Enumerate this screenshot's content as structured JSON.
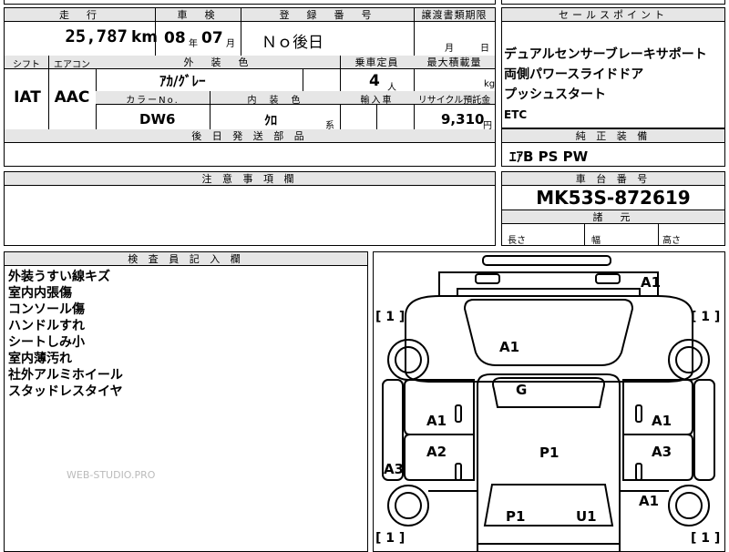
{
  "top_left": {
    "headers": {
      "mileage": "走　行",
      "inspection": "車　検",
      "registration": "登　録　番　号",
      "transfer_docs": "譲渡書類期限",
      "shift": "シフト",
      "ac": "エアコン",
      "exterior_color": "外　装　色",
      "capacity": "乗車定員",
      "max_load": "最大積載量",
      "color_no": "カラーNo.",
      "interior_color": "内　装　色",
      "import": "輸入車",
      "recycle": "リサイクル預託金",
      "later_parts": "後 日 発 送 部 品"
    },
    "values": {
      "mileage": "25,787",
      "mileage_unit": "km",
      "inspection_year": "08",
      "year_unit": "年",
      "inspection_month": "07",
      "month_unit": "月",
      "registration": "Ｎｏ後日",
      "transfer_month_unit": "月",
      "transfer_day_unit": "日",
      "shift": "IAT",
      "ac": "AAC",
      "exterior_color": "ｱｶ/ｸﾞﾚｰ",
      "capacity": "4",
      "capacity_unit": "人",
      "max_load_unit": "kg",
      "color_no": "DW6",
      "interior_color": "ｸﾛ",
      "interior_suffix": "系",
      "recycle": "9,310",
      "recycle_unit": "円"
    }
  },
  "sales_points": {
    "header": "セールスポイント",
    "items": [
      "デュアルセンサーブレーキサポート",
      "両側パワースライドドア",
      "プッシュスタート",
      "ETC"
    ]
  },
  "genuine_equipment": {
    "header": "純 正 装 備",
    "value": "ｴｱB PS PW"
  },
  "caution": {
    "header": "注 意 事 項 欄"
  },
  "chassis": {
    "header": "車 台 番 号",
    "value": "MK53S-872619"
  },
  "dimensions": {
    "header": "諸　元",
    "length": "長さ",
    "width": "幅",
    "height": "高さ"
  },
  "inspector": {
    "header": "検 査 員 記 入 欄",
    "notes": [
      "外装うすい線キズ",
      "室内内張傷",
      "コンソール傷",
      "ハンドルすれ",
      "シートしみ小",
      "室内薄汚れ",
      "社外アルミホイール",
      "スタッドレスタイヤ"
    ],
    "watermark": "WEB-STUDIO.PRO"
  },
  "diagram": {
    "marks": [
      "A1",
      "A1",
      "G",
      "A1",
      "A1",
      "A2",
      "P1",
      "A3",
      "A3",
      "A1",
      "P1",
      "U1"
    ],
    "tire_labels": [
      "[ 1 ]",
      "[ 1 ]",
      "[ 1 ]",
      "[ 1 ]"
    ]
  }
}
